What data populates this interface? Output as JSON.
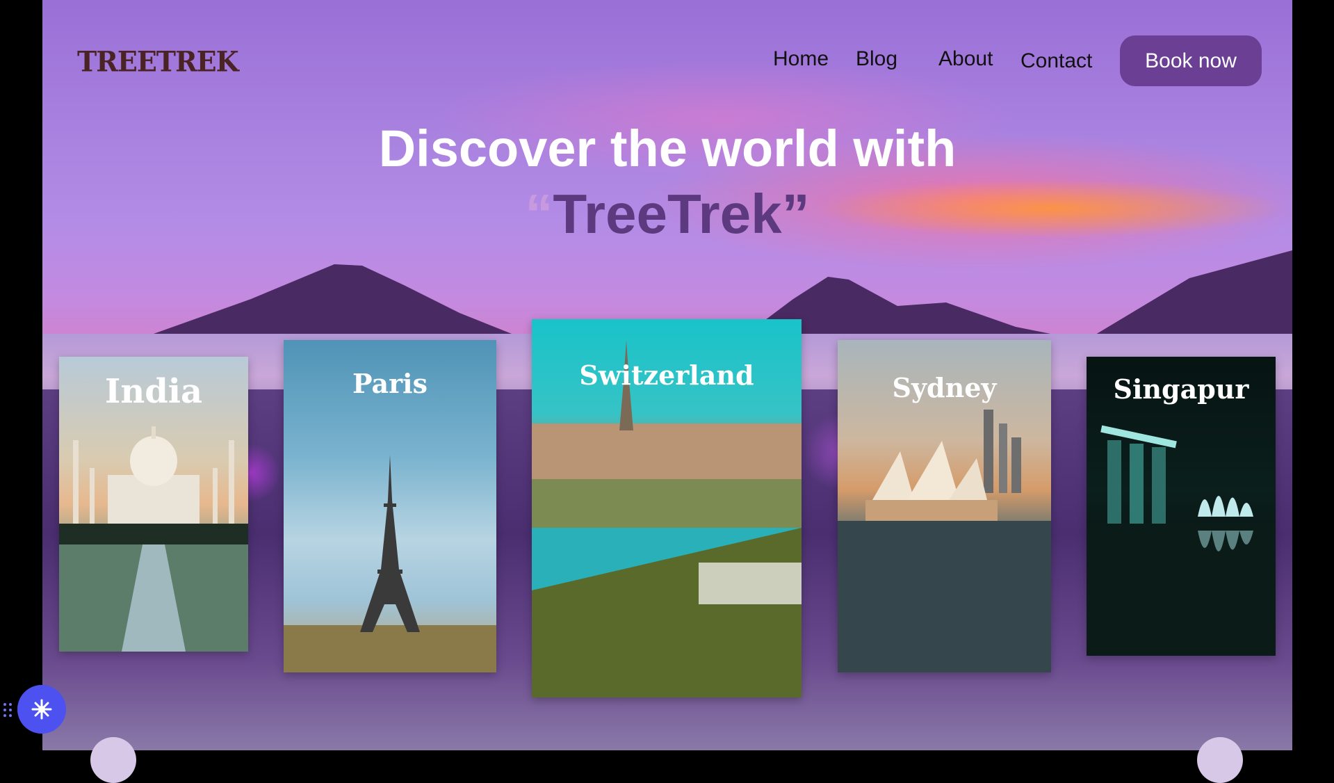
{
  "header": {
    "logo": "TREETREK",
    "nav": [
      {
        "label": "Home"
      },
      {
        "label": "Blog"
      },
      {
        "label": "About"
      },
      {
        "label": "Contact"
      }
    ],
    "cta_label": "Book now"
  },
  "hero": {
    "headline": "Discover the world with",
    "brand_open_quote": "“",
    "brand_name": "TreeTrek",
    "brand_close_quote": "”"
  },
  "destinations": [
    {
      "name": "India",
      "icon": "taj-mahal"
    },
    {
      "name": "Paris",
      "icon": "eiffel-tower"
    },
    {
      "name": "Switzerland",
      "icon": "swiss-cathedral-town"
    },
    {
      "name": "Sydney",
      "icon": "opera-house"
    },
    {
      "name": "Singapur",
      "icon": "marina-bay-sands"
    }
  ],
  "colors": {
    "brand_purple": "#6a3f94",
    "headline_white": "#ffffff",
    "brand_text": "#5d3a80",
    "fab_blue": "#4c51f0"
  }
}
